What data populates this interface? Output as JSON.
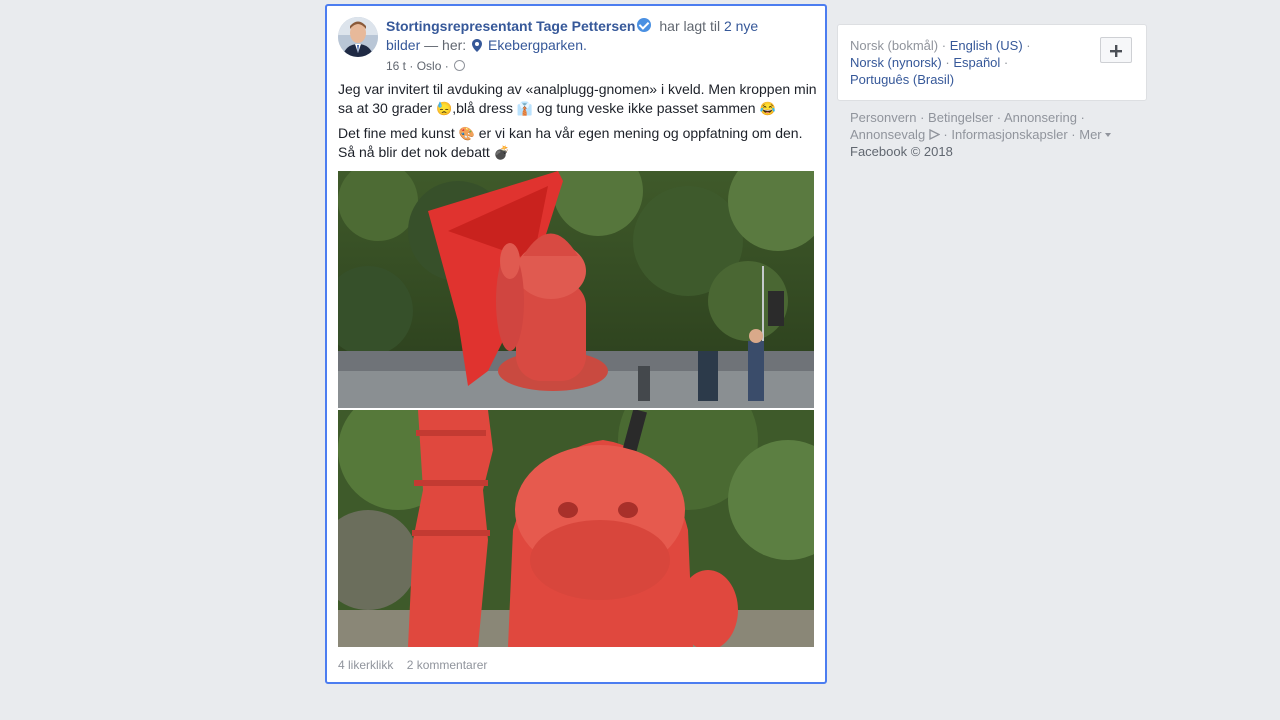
{
  "post": {
    "author": "Stortingsrepresentant Tage Pettersen",
    "action_text": "har lagt til",
    "photos_link": "2 nye bilder",
    "location_prefix": "— her:",
    "location": "Ekebergparken.",
    "time": "16 t",
    "place": "Oslo",
    "paragraph1_a": "Jeg var invitert til avduking av «analplugg-gnomen» i kveld. Men kroppen min sa at 30 grader",
    "paragraph1_b": ",blå dress",
    "paragraph1_c": "og tung veske ikke passet sammen",
    "paragraph2_a": "Det fine med kunst",
    "paragraph2_b": "er vi kan ha vår egen mening og oppfatning om den. Så nå blir det nok debatt",
    "emoji_hot": "😓",
    "emoji_tie": "👔",
    "emoji_laugh": "😂",
    "emoji_art": "🎨",
    "emoji_bomb": "💣",
    "likes": "4 likerklikk",
    "comments": "2 kommentarer"
  },
  "languages": {
    "current": "Norsk (bokmål)",
    "en": "English (US)",
    "nn": "Norsk (nynorsk)",
    "es": "Español",
    "pt": "Português (Brasil)",
    "add_icon": "plus-icon"
  },
  "footer": {
    "privacy": "Personvern",
    "terms": "Betingelser",
    "advertising": "Annonsering",
    "ad_choices": "Annonsevalg",
    "cookies": "Informasjonskapsler",
    "more": "Mer",
    "copyright": "Facebook © 2018"
  },
  "colors": {
    "link": "#365899",
    "focus_border": "#4c7df0",
    "background": "#e9ebee"
  }
}
